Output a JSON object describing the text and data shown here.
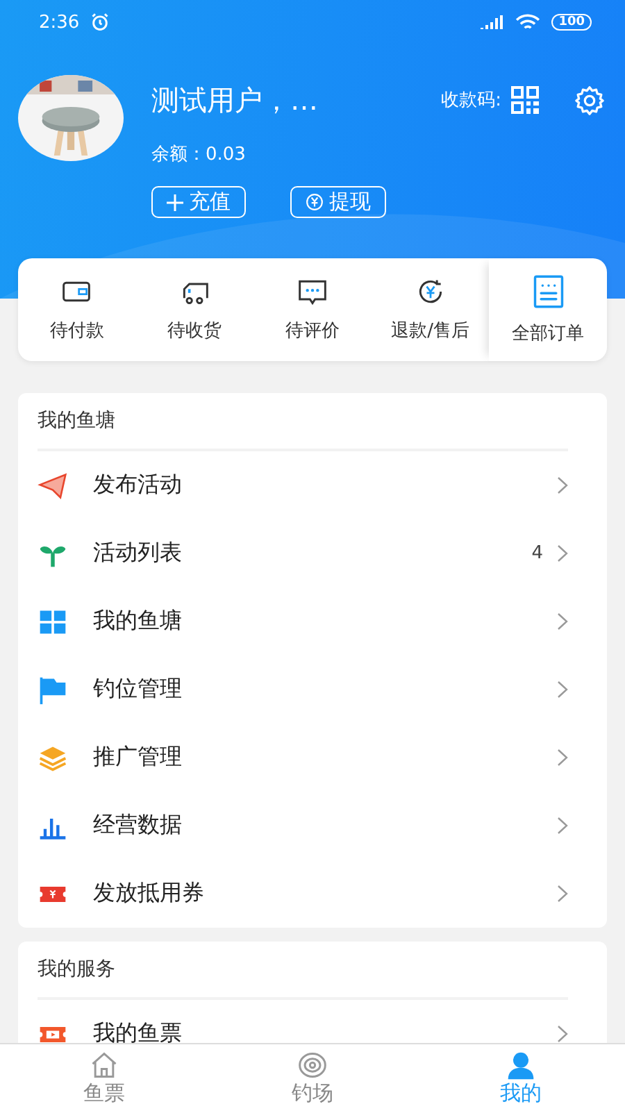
{
  "status_bar": {
    "time": "2:36",
    "battery": "100"
  },
  "profile": {
    "name": "测试用户，…",
    "balance": "余额：0.03",
    "qr_label": "收款码:",
    "buttons": [
      {
        "kind": "plus",
        "label": "充值"
      },
      {
        "kind": "yuan",
        "label": "提现"
      }
    ]
  },
  "orders": [
    {
      "kind": "wallet",
      "label": "待付款"
    },
    {
      "kind": "truck",
      "label": "待收货"
    },
    {
      "kind": "chat",
      "label": "待评价"
    },
    {
      "kind": "refund",
      "label": "退款/售后"
    },
    {
      "kind": "list",
      "label": "全部订单"
    }
  ],
  "sections": [
    {
      "title": "我的鱼塘",
      "items": [
        {
          "kind": "plane",
          "label": "发布活动"
        },
        {
          "kind": "sprout",
          "label": "活动列表",
          "count": "4"
        },
        {
          "kind": "grid",
          "label": "我的鱼塘"
        },
        {
          "kind": "flag",
          "label": "钓位管理"
        },
        {
          "kind": "layers",
          "label": "推广管理"
        },
        {
          "kind": "bars",
          "label": "经营数据"
        },
        {
          "kind": "coupon",
          "label": "发放抵用券"
        }
      ]
    },
    {
      "title": "我的服务",
      "items": [
        {
          "kind": "ticket",
          "label": "我的鱼票"
        }
      ]
    }
  ],
  "tabs": [
    {
      "kind": "home",
      "label": "鱼票",
      "selected": false
    },
    {
      "kind": "target",
      "label": "钓场",
      "selected": false
    },
    {
      "kind": "person",
      "label": "我的",
      "selected": true
    }
  ]
}
